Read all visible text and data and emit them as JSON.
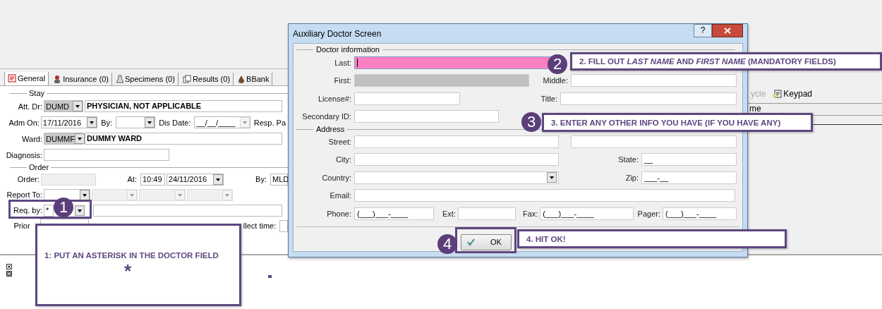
{
  "app": {
    "tabs": [
      {
        "label": "General",
        "selected": true
      },
      {
        "label": "Insurance (0)",
        "selected": false
      },
      {
        "label": "Specimens (0)",
        "selected": false
      },
      {
        "label": "Results (0)",
        "selected": false
      },
      {
        "label": "BBank",
        "selected": false
      }
    ],
    "stay": {
      "title": "Stay",
      "att_dr": {
        "label": "Att. Dr:",
        "code": "DUMD",
        "name": "PHYSICIAN, NOT APPLICABLE"
      },
      "adm_on": {
        "label": "Adm On:",
        "value": "17/11/2016"
      },
      "by": {
        "label": "By:"
      },
      "dis_date": {
        "label": "Dis Date:",
        "value": "__/__/____"
      },
      "resp": {
        "label": "Resp. Pa"
      },
      "ward": {
        "label": "Ward:",
        "code": "DUMMF",
        "name": "DUMMY WARD"
      },
      "diagnosis": {
        "label": "Diagnosis:"
      }
    },
    "order": {
      "title": "Order",
      "order": {
        "label": "Order:"
      },
      "at": {
        "label": "At:",
        "time": "10:49",
        "date": "24/11/2016"
      },
      "by": {
        "label": "By:",
        "value": "MLD"
      },
      "report_to": {
        "label": "Report To:"
      },
      "req_by": {
        "label": "Req. by:",
        "value": "*"
      },
      "priority": {
        "label": "Prior"
      },
      "collect_time": {
        "label": "llect time:"
      }
    },
    "toolbar": [
      {
        "label": "ycle",
        "disabled": true
      },
      {
        "label": "Keypad",
        "disabled": false
      }
    ],
    "grid_header": "me"
  },
  "dialog": {
    "title": "Auxiliary Doctor Screen",
    "help": "?",
    "doctor_group": "Doctor information",
    "address_group": "Address",
    "last": {
      "label": "Last:",
      "highlighted": true
    },
    "first": {
      "label": "First:",
      "disabled": true
    },
    "middle": {
      "label": "Middle:"
    },
    "license": {
      "label": "License#:"
    },
    "title_field": {
      "label": "Title:"
    },
    "secondary_id": {
      "label": "Secondary ID:"
    },
    "street": {
      "label": "Street:"
    },
    "city": {
      "label": "City:"
    },
    "state": {
      "label": "State:",
      "value": "__"
    },
    "country": {
      "label": "Country:"
    },
    "zip": {
      "label": "Zip:",
      "value": "___-__"
    },
    "email": {
      "label": "Email:"
    },
    "phone": {
      "label": "Phone:",
      "value": "(___)___-____"
    },
    "ext": {
      "label": "Ext:"
    },
    "fax": {
      "label": "Fax:",
      "value": "(___)___-____"
    },
    "pager": {
      "label": "Pager:",
      "value": "(___)___-____"
    },
    "ok": "OK"
  },
  "callouts": [
    {
      "number": "1",
      "text": "1: PUT AN ASTERISK IN THE DOCTOR FIELD",
      "symbol": "*"
    },
    {
      "number": "2",
      "text": "2. FILL OUT *LAST NAME* AND *FIRST NAME* (MANDATORY FIELDS)"
    },
    {
      "number": "3",
      "text": "3. ENTER ANY OTHER INFO YOU HAVE (IF YOU HAVE ANY)"
    },
    {
      "number": "4",
      "text": "4. HIT OK!"
    }
  ]
}
